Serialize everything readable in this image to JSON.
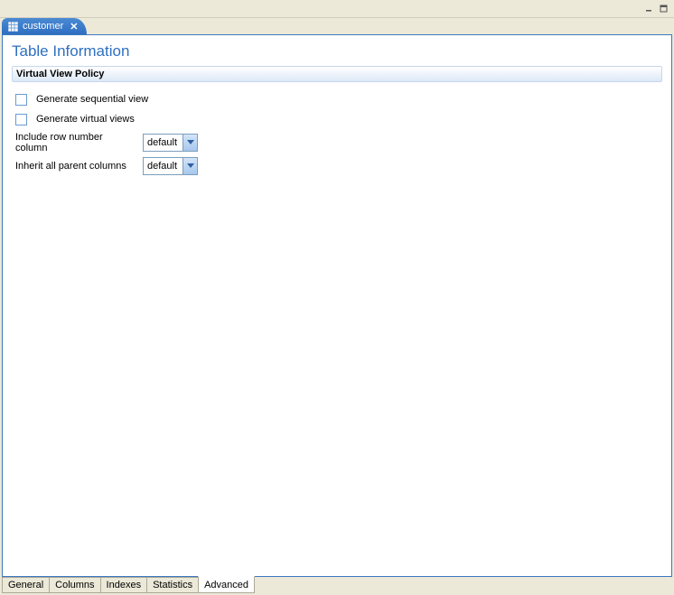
{
  "window": {
    "minimize_title": "Minimize",
    "maximize_title": "Maximize"
  },
  "docTab": {
    "label": "customer",
    "close": "✕"
  },
  "page": {
    "title": "Table Information"
  },
  "section": {
    "header": "Virtual View Policy",
    "cb1": "Generate sequential view",
    "cb2": "Generate virtual views",
    "field1_label": "Include row number column",
    "field1_value": "default",
    "field2_label": "Inherit all parent columns",
    "field2_value": "default"
  },
  "bottomTabs": {
    "t0": "General",
    "t1": "Columns",
    "t2": "Indexes",
    "t3": "Statistics",
    "t4": "Advanced"
  }
}
